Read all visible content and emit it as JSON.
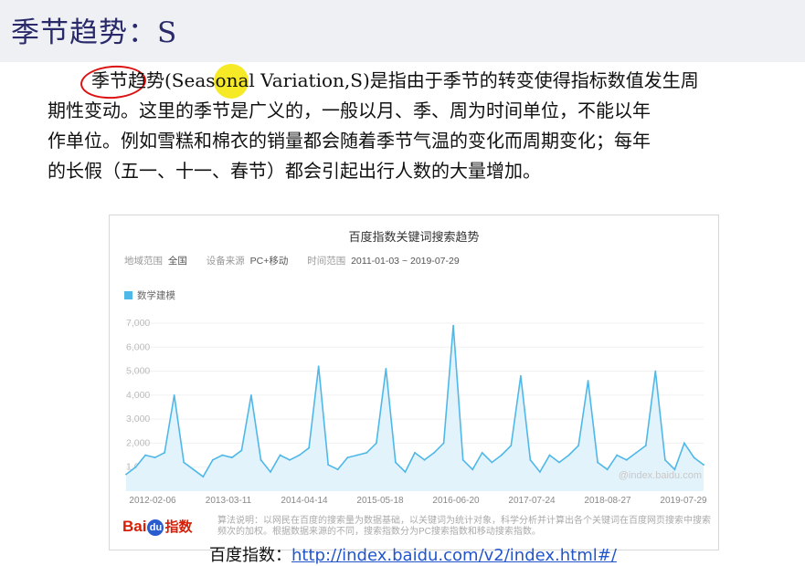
{
  "slide": {
    "title": "季节趋势：S",
    "paragraph": [
      "季节趋势(Seasonal Variation,S)是指由于季节的转变使得指标数值发生周",
      "期性变动。这里的季节是广义的，一般以月、季、周为时间单位，不能以年",
      "作单位。例如雪糕和棉衣的销量都会随着季节气温的变化而周期变化；每年",
      "的长假（五一、十一、春节）都会引起出行人数的大量增加。"
    ],
    "source_label": "百度指数：",
    "source_url": "http://index.baidu.com/v2/index.html#/"
  },
  "chart_meta": {
    "region_label": "地域范围",
    "region_value": "全国",
    "device_label": "设备来源",
    "device_value": "PC+移动",
    "time_label": "时间范围",
    "time_value": "2011-01-03 ~ 2019-07-29",
    "watermark": "@index.baidu.com",
    "logo_left": "Bai",
    "logo_mid": "du",
    "logo_right": "指数",
    "note": "算法说明：以网民在百度的搜索量为数据基础，以关键词为统计对象，科学分析并计算出各个关键词在百度网页搜索中搜索频次的加权。根据数据来源的不同，搜索指数分为PC搜索指数和移动搜索指数。"
  },
  "colors": {
    "line": "#4fb8e8",
    "area": "#e3f3fb",
    "title": "#2a2a6a",
    "link": "#2255cc"
  },
  "chart_data": {
    "type": "area",
    "title": "百度指数关键词搜索趋势",
    "series": [
      {
        "name": "数学建模",
        "x": [
          "2011-01",
          "2011-03",
          "2011-05",
          "2011-07",
          "2011-08",
          "2011-09",
          "2011-10",
          "2011-12",
          "2012-02",
          "2012-04",
          "2012-06",
          "2012-08",
          "2012-09",
          "2012-10",
          "2012-12",
          "2013-02",
          "2013-04",
          "2013-06",
          "2013-08",
          "2013-09",
          "2013-10",
          "2013-12",
          "2014-02",
          "2014-04",
          "2014-06",
          "2014-08",
          "2014-09",
          "2014-10",
          "2014-12",
          "2015-02",
          "2015-04",
          "2015-06",
          "2015-08",
          "2015-09",
          "2015-10",
          "2015-12",
          "2016-02",
          "2016-04",
          "2016-06",
          "2016-08",
          "2016-09",
          "2016-10",
          "2016-12",
          "2017-02",
          "2017-04",
          "2017-06",
          "2017-08",
          "2017-09",
          "2017-10",
          "2017-12",
          "2018-02",
          "2018-04",
          "2018-06",
          "2018-08",
          "2018-09",
          "2018-10",
          "2018-12",
          "2019-02",
          "2019-04",
          "2019-06",
          "2019-07"
        ],
        "values": [
          700,
          1000,
          1500,
          1400,
          1600,
          4000,
          1200,
          900,
          600,
          1300,
          1500,
          1400,
          1700,
          4000,
          1300,
          800,
          1500,
          1300,
          1500,
          1800,
          5200,
          1100,
          900,
          1400,
          1500,
          1600,
          2000,
          5100,
          1200,
          800,
          1600,
          1300,
          1600,
          2000,
          6900,
          1300,
          900,
          1600,
          1200,
          1500,
          1900,
          4800,
          1300,
          800,
          1500,
          1200,
          1500,
          1900,
          4600,
          1200,
          900,
          1500,
          1300,
          1600,
          1900,
          5000,
          1300,
          900,
          2000,
          1400,
          1100
        ]
      }
    ],
    "x_tick_labels": [
      "2012-02-06",
      "2013-03-11",
      "2014-04-14",
      "2015-05-18",
      "2016-06-20",
      "2017-07-24",
      "2018-08-27",
      "2019-07-29"
    ],
    "y_tick_labels": [
      "1,000",
      "2,000",
      "3,000",
      "4,000",
      "5,000",
      "6,000",
      "7,000"
    ],
    "ylim": [
      0,
      7000
    ],
    "grid": true,
    "legend_position": "top-left"
  }
}
